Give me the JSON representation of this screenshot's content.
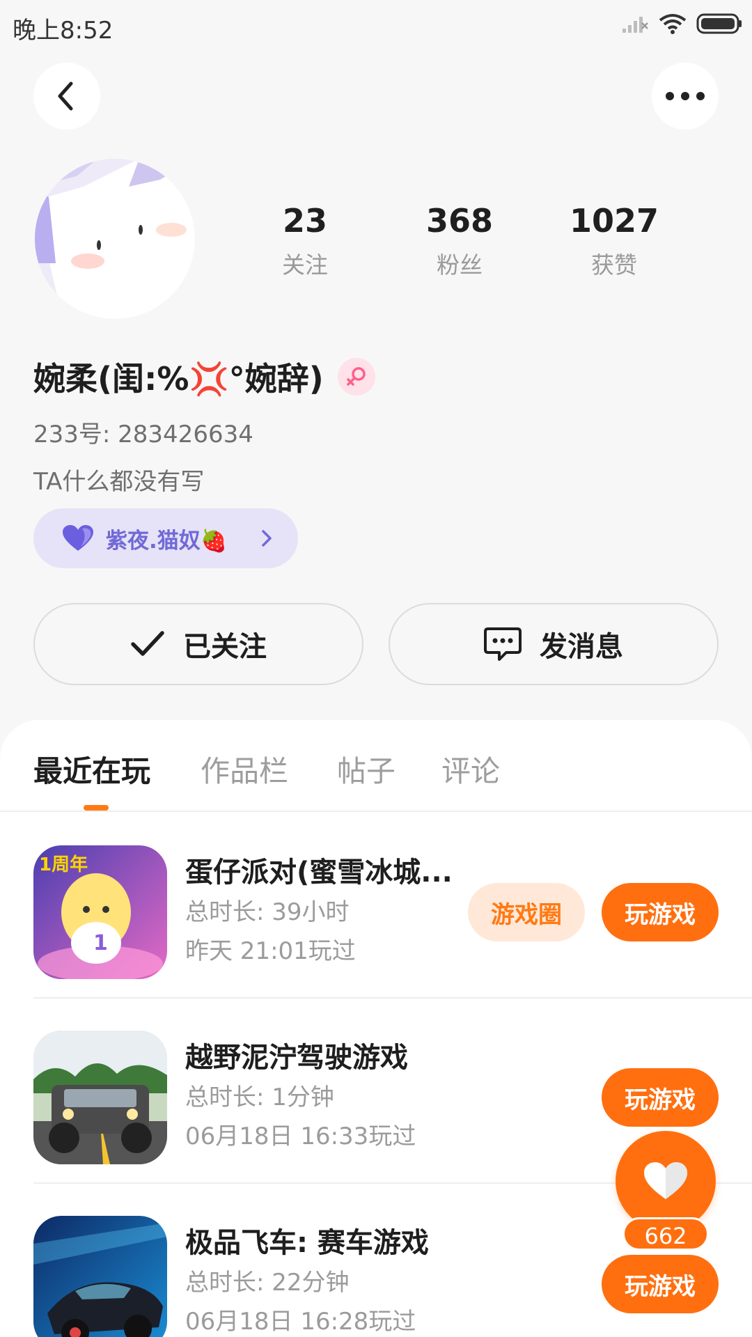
{
  "status_bar": {
    "time": "晚上8:52"
  },
  "header": {
    "back_icon": "chevron-left-icon",
    "more_icon": "ellipsis-icon"
  },
  "profile": {
    "stats": [
      {
        "value": "23",
        "label": "关注"
      },
      {
        "value": "368",
        "label": "粉丝"
      },
      {
        "value": "1027",
        "label": "获赞"
      }
    ],
    "username": "婉柔(闺:%💢°婉辞)",
    "gender_icon": "female-icon",
    "account_id": "233号: 283426634",
    "bio": "TA什么都没有写",
    "club": {
      "label": "紫夜.猫奴🍓",
      "icon": "heart-icon"
    },
    "actions": {
      "follow": "已关注",
      "message": "发消息"
    }
  },
  "tabs": [
    "最近在玩",
    "作品栏",
    "帖子",
    "评论"
  ],
  "games": [
    {
      "title": "蛋仔派对(蜜雪冰城...",
      "duration": "总时长: 39小时",
      "last_played": "昨天 21:01玩过",
      "circle_label": "游戏圈",
      "play_label": "玩游戏"
    },
    {
      "title": "越野泥泞驾驶游戏",
      "duration": "总时长: 1分钟",
      "last_played": "06月18日 16:33玩过",
      "play_label": "玩游戏"
    },
    {
      "title": "极品飞车: 赛车游戏",
      "duration": "总时长: 22分钟",
      "last_played": "06月18日 16:28玩过",
      "play_label": "玩游戏"
    }
  ],
  "like": {
    "count": "662"
  },
  "colors": {
    "accent": "#ff6f0f",
    "club_bg": "#e6e3f8",
    "club_text": "#7169d6"
  }
}
